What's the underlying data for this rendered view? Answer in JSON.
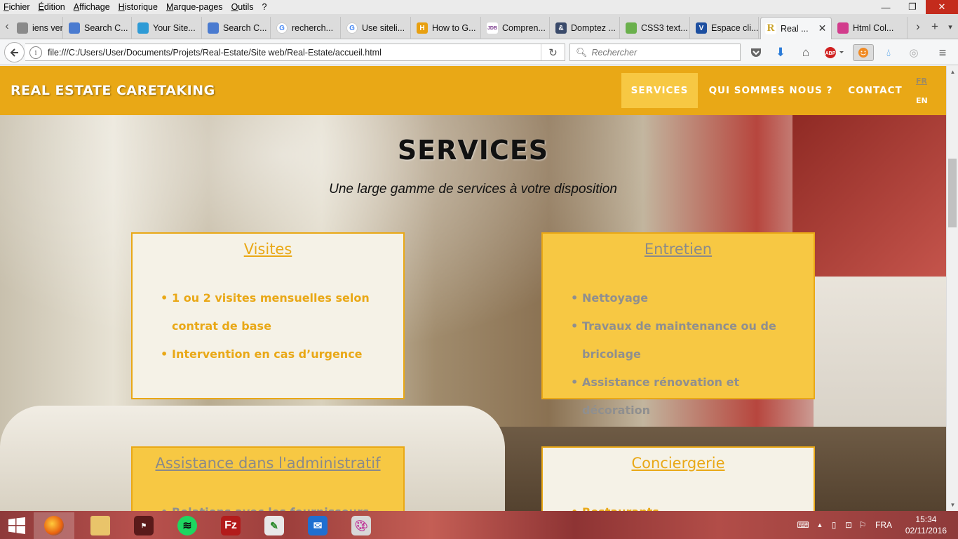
{
  "browser": {
    "menu": [
      "Fichier",
      "Édition",
      "Affichage",
      "Historique",
      "Marque-pages",
      "Outils",
      "?"
    ],
    "window_controls": {
      "minimize": "—",
      "maximize": "❐",
      "close": "✕"
    },
    "tabs": [
      {
        "label": "iens vers...",
        "color": "#8a8a8a",
        "glyph": ""
      },
      {
        "label": "Search C...",
        "color": "#4a7bd0",
        "glyph": ""
      },
      {
        "label": "Your Site...",
        "color": "#2e9bd6",
        "glyph": ""
      },
      {
        "label": "Search C...",
        "color": "#4a7bd0",
        "glyph": ""
      },
      {
        "label": "recherch...",
        "color": "#ffffff",
        "glyph": "G"
      },
      {
        "label": "Use siteli...",
        "color": "#ffffff",
        "glyph": "G"
      },
      {
        "label": "How to G...",
        "color": "#e8a010",
        "glyph": "H"
      },
      {
        "label": "Compren...",
        "color": "#ffffff",
        "glyph": "JDB"
      },
      {
        "label": "Domptez ...",
        "color": "#3a4a6a",
        "glyph": "&"
      },
      {
        "label": "CSS3 text...",
        "color": "#6ab04c",
        "glyph": ""
      },
      {
        "label": "Espace cli...",
        "color": "#1d4fa0",
        "glyph": "V"
      },
      {
        "label": "Real ...",
        "color": "#ffffff",
        "glyph": "R"
      },
      {
        "label": "Html Col...",
        "color": "#d23c8c",
        "glyph": ""
      }
    ],
    "url": "file:///C:/Users/User/Documents/Projets/Real-Estate/Site web/Real-Estate/accueil.html",
    "search_placeholder": "Rechercher"
  },
  "site": {
    "brand": "REAL ESTATE CARETAKING",
    "nav": [
      "SERVICES",
      "QUI SOMMES NOUS ?",
      "CONTACT"
    ],
    "lang": [
      "FR",
      "EN"
    ],
    "title": "SERVICES",
    "subtitle": "Une large gamme de services à votre disposition",
    "cards": [
      {
        "title": "Visites",
        "items": [
          "1 ou 2 visites mensuelles selon contrat de base",
          "Intervention en cas d’urgence"
        ]
      },
      {
        "title": "Entretien",
        "items": [
          "Nettoyage",
          "Travaux de maintenance ou de bricolage",
          "Assistance rénovation et décoration"
        ]
      },
      {
        "title": "Assistance dans l'administratif",
        "items": [
          "Relations avec les fournisseurs"
        ]
      },
      {
        "title": "Conciergerie",
        "items": [
          "Restaurants"
        ]
      }
    ]
  },
  "taskbar": {
    "apps": [
      "firefox",
      "explorer",
      "app-red",
      "spotify",
      "filezilla",
      "notepad",
      "mail",
      "paint"
    ],
    "lang": "FRA",
    "time": "15:34",
    "date": "02/11/2016"
  },
  "colors": {
    "gold": "#e9a816",
    "gold_light": "#f7c843",
    "cream": "#f5f2e7"
  }
}
